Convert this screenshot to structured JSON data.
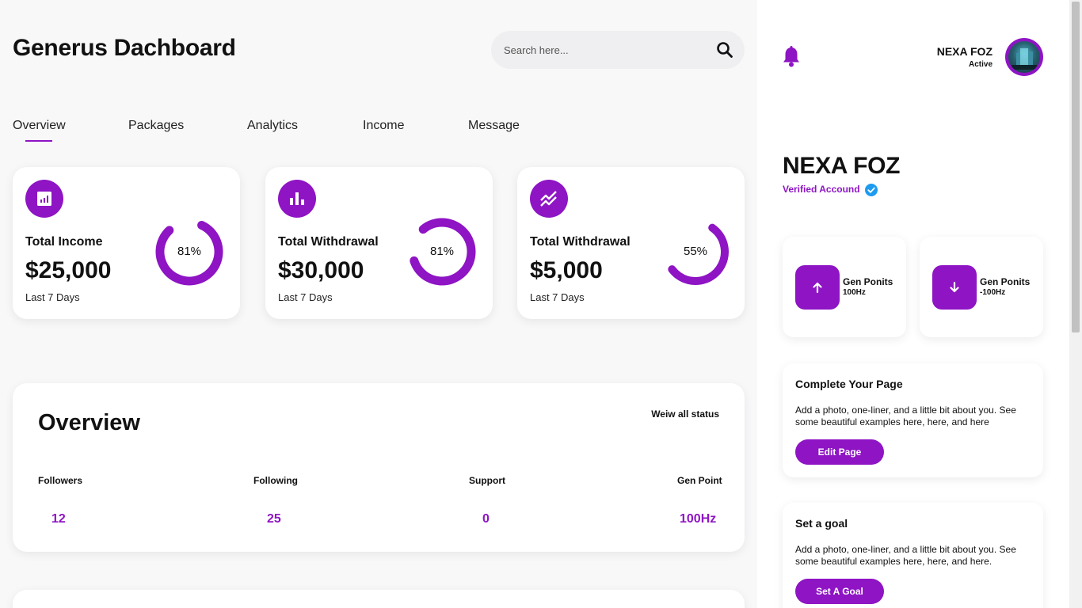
{
  "header": {
    "title": "Generus Dachboard",
    "search_placeholder": "Search here..."
  },
  "tabs": [
    {
      "label": "Overview",
      "active": true
    },
    {
      "label": "Packages",
      "active": false
    },
    {
      "label": "Analytics",
      "active": false
    },
    {
      "label": "Income",
      "active": false
    },
    {
      "label": "Message",
      "active": false
    }
  ],
  "stat_cards": [
    {
      "icon": "report-chart-icon",
      "label": "Total Income",
      "amount": "$25,000",
      "period": "Last 7 Days",
      "percent": 81,
      "percent_label": "81%"
    },
    {
      "icon": "bar-chart-icon",
      "label": "Total Withdrawal",
      "amount": "$30,000",
      "period": "Last 7 Days",
      "percent": 81,
      "percent_label": "81%"
    },
    {
      "icon": "trending-icon",
      "label": "Total Withdrawal",
      "amount": "$5,000",
      "period": "Last 7 Days",
      "percent": 55,
      "percent_label": "55%"
    }
  ],
  "overview": {
    "title": "Overview",
    "view_all": "Weiw all status",
    "stats": [
      {
        "label": "Followers",
        "value": "12"
      },
      {
        "label": "Following",
        "value": "25"
      },
      {
        "label": "Support",
        "value": "0"
      },
      {
        "label": "Gen Point",
        "value": "100Hz"
      }
    ]
  },
  "user": {
    "name": "NEXA FOZ",
    "status": "Active"
  },
  "profile": {
    "name": "NEXA FOZ",
    "verified_label": "Verified Accound"
  },
  "gen_points": [
    {
      "title": "Gen Ponits",
      "value": "100Hz",
      "direction": "up"
    },
    {
      "title": "Gen Ponits",
      "value": "-100Hz",
      "direction": "down"
    }
  ],
  "complete_page": {
    "title": "Complete Your Page",
    "text": "Add a photo, one-liner, and a little bit about you. See some beautiful examples here, here, and here",
    "button": "Edit Page"
  },
  "set_goal": {
    "title": "Set a goal",
    "text": "Add a photo, one-liner, and a little bit about you. See some beautiful examples here, here, and here.",
    "button": "Set A Goal"
  },
  "colors": {
    "accent": "#8e14c4",
    "background": "#f8f8f9",
    "card": "#ffffff"
  }
}
